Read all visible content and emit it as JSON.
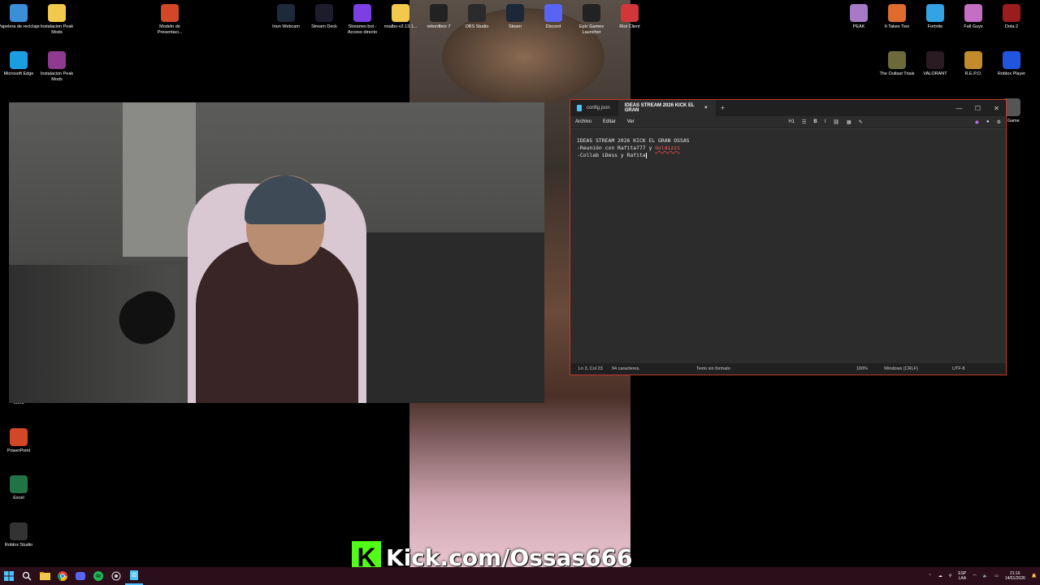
{
  "desktop_icons_left": [
    {
      "label": "Papelera de reciclaje",
      "icon": "recycle-bin-icon",
      "color": "#3b8ed8"
    },
    {
      "label": "Instalacion Peak Mods",
      "icon": "folder-icon",
      "color": "#f2c94c"
    },
    {
      "label": "Modelo de Presentaci...",
      "icon": "powerpoint-icon",
      "color": "#d24726"
    },
    {
      "label": "Microsoft Edge",
      "icon": "edge-icon",
      "color": "#1b9de2"
    },
    {
      "label": "Instalacion Peak Mods",
      "icon": "winrar-icon",
      "color": "#8e3a8f"
    },
    {
      "label": "Word",
      "icon": "word-icon",
      "color": "#2b579a"
    },
    {
      "label": "PowerPoint",
      "icon": "powerpoint-icon",
      "color": "#d24726"
    },
    {
      "label": "Excel",
      "icon": "excel-icon",
      "color": "#217346"
    },
    {
      "label": "Roblox Studio",
      "icon": "roblox-studio-icon",
      "color": "#333333"
    }
  ],
  "desktop_icons_top": [
    {
      "label": "Iriun Webcam",
      "icon": "webcam-icon",
      "color": "#1e2a3a"
    },
    {
      "label": "Stream Deck",
      "icon": "stream-deck-icon",
      "color": "#1c1c2c"
    },
    {
      "label": "Streamer.bot - Acceso directo",
      "icon": "streamerbot-icon",
      "color": "#7b3fe4"
    },
    {
      "label": "noalbs-v2.13.1...",
      "icon": "folder-icon",
      "color": "#f2c94c"
    },
    {
      "label": "rekordbox 7",
      "icon": "rekordbox-icon",
      "color": "#222222"
    },
    {
      "label": "OBS Studio",
      "icon": "obs-icon",
      "color": "#2b2b2b"
    },
    {
      "label": "Steam",
      "icon": "steam-icon",
      "color": "#1b2838"
    },
    {
      "label": "Discord",
      "icon": "discord-icon",
      "color": "#5865f2"
    },
    {
      "label": "Epic Games Launcher",
      "icon": "epic-games-icon",
      "color": "#222222"
    },
    {
      "label": "Riot Client",
      "icon": "riot-icon",
      "color": "#d13639"
    }
  ],
  "desktop_icons_right": [
    {
      "label": "PEAK",
      "icon": "peak-icon",
      "color": "#a77ac8"
    },
    {
      "label": "It Takes Two",
      "icon": "it-takes-two-icon",
      "color": "#e06b2e"
    },
    {
      "label": "Fortnite",
      "icon": "fortnite-icon",
      "color": "#34a3e6"
    },
    {
      "label": "Fall Guys",
      "icon": "fall-guys-icon",
      "color": "#c46fc4"
    },
    {
      "label": "Dota 2",
      "icon": "dota2-icon",
      "color": "#9b1c1c"
    },
    {
      "label": "The Outlast Trials",
      "icon": "outlast-icon",
      "color": "#6a6a3a"
    },
    {
      "label": "VALORANT",
      "icon": "valorant-icon",
      "color": "#2a1a22"
    },
    {
      "label": "R.E.P.O.",
      "icon": "repo-icon",
      "color": "#c28b2b"
    },
    {
      "label": "Roblox Player",
      "icon": "roblox-icon",
      "color": "#2255dd"
    },
    {
      "label": "b Game",
      "icon": "game-icon",
      "color": "#555555"
    }
  ],
  "notepad": {
    "tabs": [
      {
        "label": "config.json",
        "active": false
      },
      {
        "label": "IDEAS STREAM 2026 KICK EL GRAN",
        "active": true
      }
    ],
    "close_tab": "×",
    "new_tab": "+",
    "window_controls": {
      "minimize": "—",
      "maximize": "☐",
      "close": "✕"
    },
    "menu": [
      "Archivo",
      "Editar",
      "Ver"
    ],
    "toolbar": {
      "heading": "H1",
      "list": "☰",
      "bold": "B",
      "italic": "I",
      "link": "⛓",
      "table": "▦",
      "clear": "✎"
    },
    "content": {
      "line1": "IDEAS STREAM 2026 KICK EL GRAN OSSAS",
      "line2_prefix": "-Reunión con Rafita777 y ",
      "line2_err": "Goldizzi",
      "line3": "-Collab iDess y Rafita"
    },
    "status": {
      "position": "Ln 3, Col 23",
      "chars": "94 caracteres.",
      "format": "Texto sin formato",
      "zoom": "100%",
      "line_ending": "Windows (CRLF)",
      "encoding": "UTF-8"
    }
  },
  "banner": {
    "logo": "K",
    "text": "Kick.com/Ossas666",
    "color": "#53fc18"
  },
  "taskbar": {
    "tray_lang": "ESP",
    "tray_layout": "LAA",
    "time": "21:16",
    "date": "14/01/2026"
  }
}
